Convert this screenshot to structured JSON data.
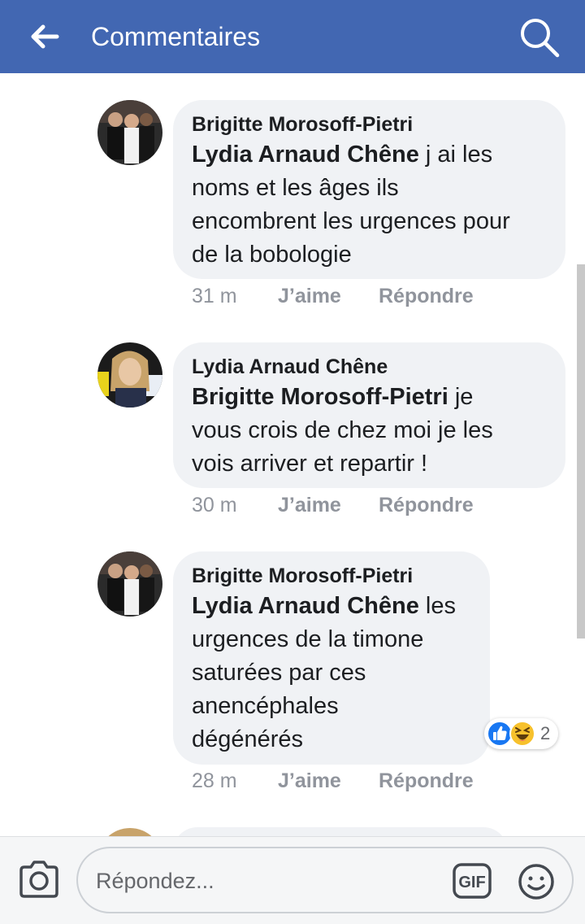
{
  "header": {
    "title": "Commentaires",
    "back_icon": "arrow-left-icon",
    "search_icon": "search-icon",
    "bg_color": "#4267b2"
  },
  "comments": [
    {
      "author": "Brigitte Morosoff-Pietri",
      "mention": "Lydia Arnaud Chêne",
      "lines": [
        " j ai les",
        "noms et les âges ils",
        "encombrent les urgences pour",
        "de la bobologie"
      ],
      "time": "31 m",
      "like_label": "J’aime",
      "reply_label": "Répondre"
    },
    {
      "author": "Lydia Arnaud Chêne",
      "mention": "Brigitte Morosoff-Pietri",
      "lines": [
        " je",
        "vous crois de chez moi je les",
        "vois arriver et repartir !"
      ],
      "time": "30 m",
      "like_label": "J’aime",
      "reply_label": "Répondre"
    },
    {
      "author": "Brigitte Morosoff-Pietri",
      "mention": "Lydia Arnaud Chêne",
      "lines": [
        " les",
        "urgences de la timone",
        "saturées par ces",
        "anencéphales",
        "dégénérés"
      ],
      "time": "28 m",
      "like_label": "J’aime",
      "reply_label": "Répondre",
      "reactions": {
        "icons": [
          "like-reaction-icon",
          "haha-reaction-icon"
        ],
        "count": "2"
      }
    }
  ],
  "composer": {
    "camera_icon": "camera-icon",
    "placeholder": "Répondez...",
    "gif_label": "GIF",
    "emoji_icon": "smiley-icon"
  }
}
